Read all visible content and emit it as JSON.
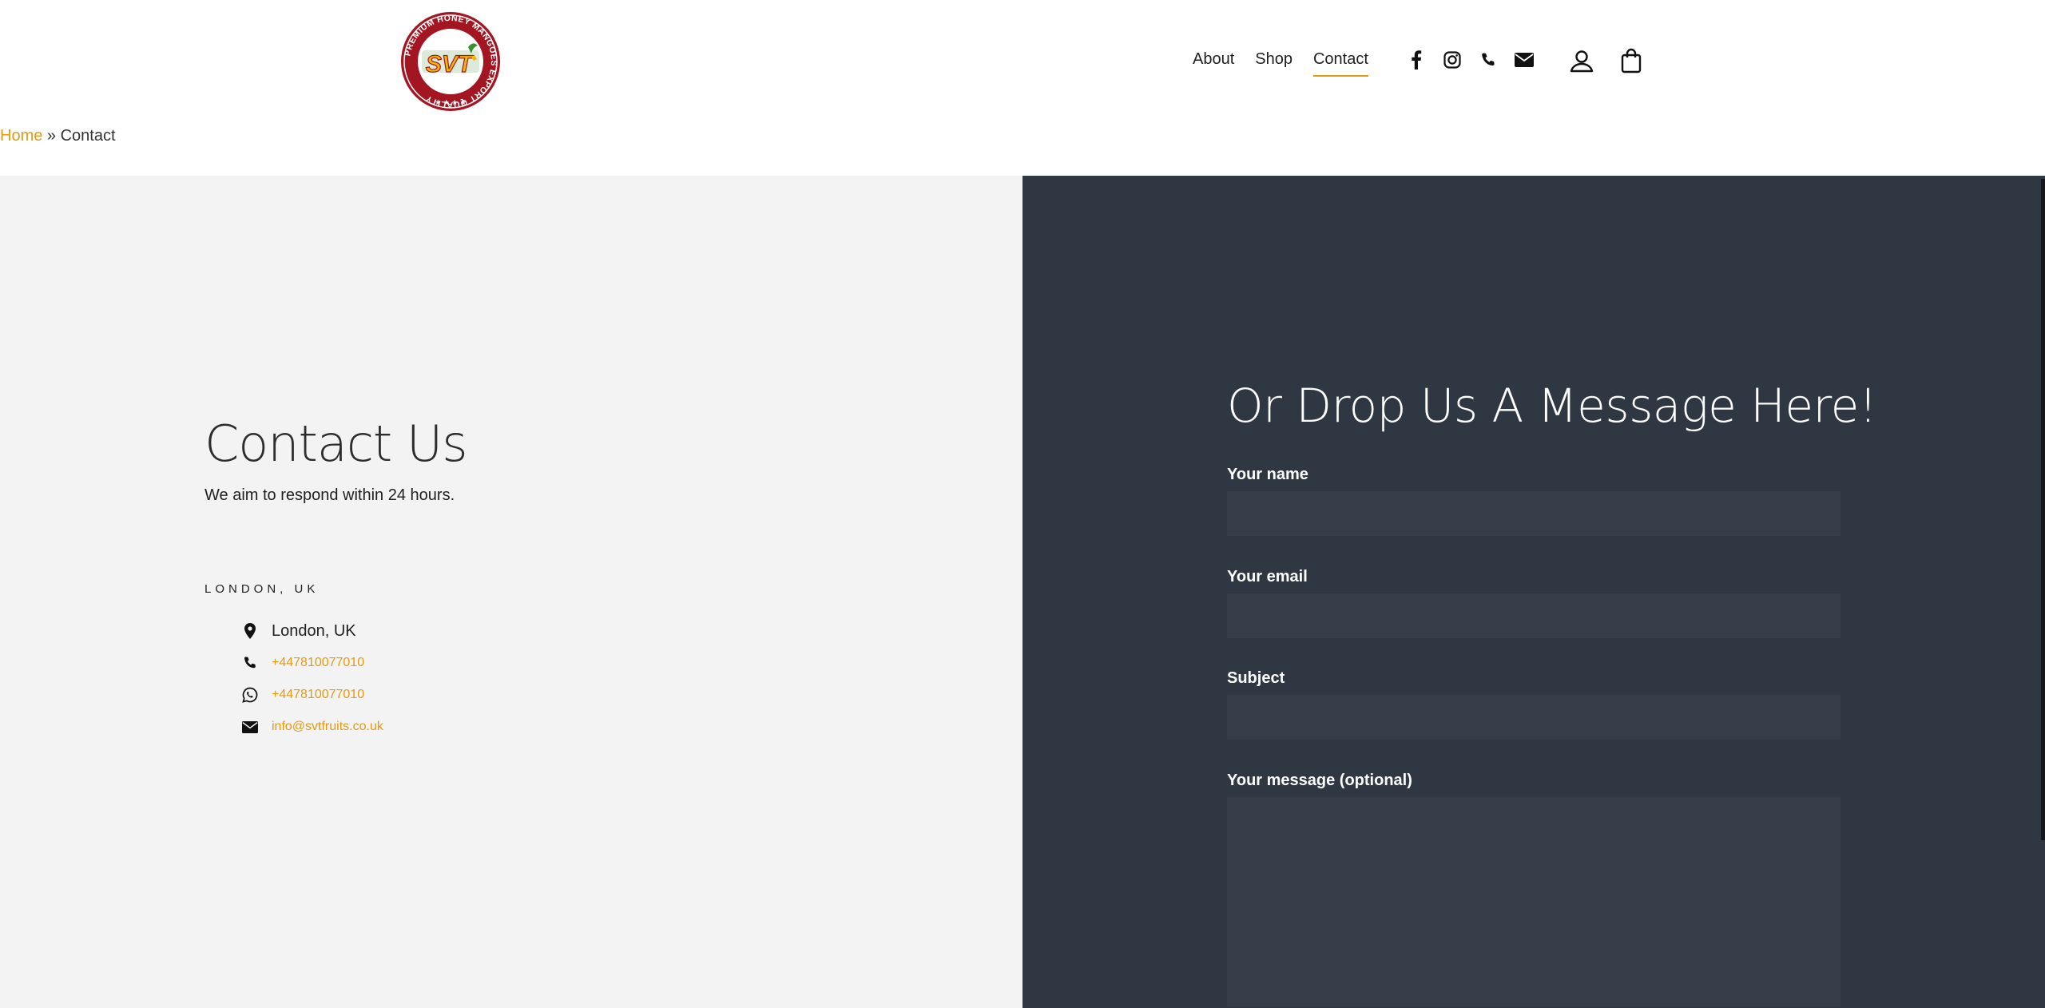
{
  "header": {
    "logo": {
      "brand": "SVT",
      "ring_text": "PREMIUM HONEY MANGOES EXPORT QUALITY"
    },
    "nav": [
      {
        "label": "About"
      },
      {
        "label": "Shop"
      },
      {
        "label": "Contact",
        "active": true
      }
    ],
    "social_icons": [
      "facebook-icon",
      "instagram-icon",
      "phone-icon",
      "envelope-icon"
    ],
    "utility_icons": [
      "user-account-icon",
      "shopping-bag-icon"
    ]
  },
  "breadcrumb": {
    "home": "Home",
    "separator": "»",
    "current": "Contact"
  },
  "contact": {
    "title": "Contact Us",
    "subtitle": "We aim to respond within 24 hours.",
    "location_heading": "LONDON, UK",
    "items": [
      {
        "icon": "map-pin-icon",
        "text": "London, UK"
      },
      {
        "icon": "phone-icon",
        "text": "+447810077010"
      },
      {
        "icon": "whatsapp-icon",
        "text": "+447810077010"
      },
      {
        "icon": "envelope-icon",
        "text": "info@svtfruits.co.uk"
      }
    ]
  },
  "form": {
    "title": "Or Drop Us A Message Here!",
    "name_label": "Your name",
    "name_value": "",
    "email_label": "Your email",
    "email_value": "",
    "subject_label": "Subject",
    "subject_value": "",
    "message_label": "Your message (optional)",
    "message_value": ""
  },
  "colors": {
    "accent": "#e39a12",
    "left_bg": "#f3f3f3",
    "right_bg": "#2e3742",
    "field_bg": "#353e48",
    "logo_red": "#a31621",
    "logo_yellow": "#f2b705",
    "logo_green": "#3c8f2f"
  }
}
